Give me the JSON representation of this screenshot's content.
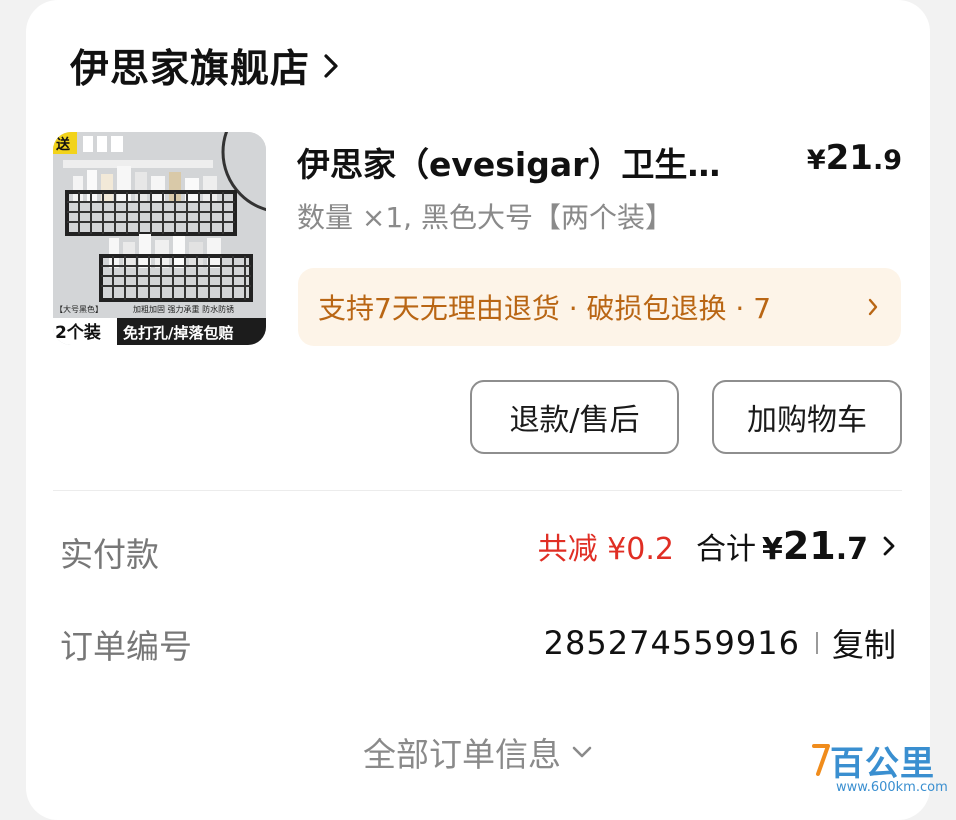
{
  "shop": {
    "name": "伊思家旗舰店",
    "chevron_icon": "chevron-right-icon"
  },
  "product": {
    "title": "伊思家（evesigar）卫生…",
    "price": {
      "currency": "¥",
      "integer": "21",
      "decimal": ".9"
    },
    "sku": "数量 ×1, 黑色大号【两个装】",
    "thumb": {
      "badge": "送",
      "tag_small": "【大号黑色】",
      "tag_count": "2个装",
      "features": "加粗加固  强力承重  防水防锈",
      "bottom_text": "免打孔/掉落包赔"
    },
    "service": {
      "text": "支持7天无理由退货 · 破损包退换 · 7"
    }
  },
  "buttons": {
    "refund": "退款/售后",
    "add_cart": "加购物车"
  },
  "payment": {
    "label": "实付款",
    "discount": "共减 ¥0.2",
    "total_label": "合计",
    "total_currency": "¥",
    "total_integer": "21",
    "total_decimal": ".7"
  },
  "order": {
    "label": "订单编号",
    "number": "285274559916",
    "copy": "复制"
  },
  "footer": {
    "all_info": "全部订单信息"
  },
  "watermark": {
    "main": "百公里",
    "url": "www.600km.com"
  },
  "colors": {
    "discount_red": "#e02e24",
    "service_bg": "#fdf4e8",
    "service_text": "#b96614"
  }
}
